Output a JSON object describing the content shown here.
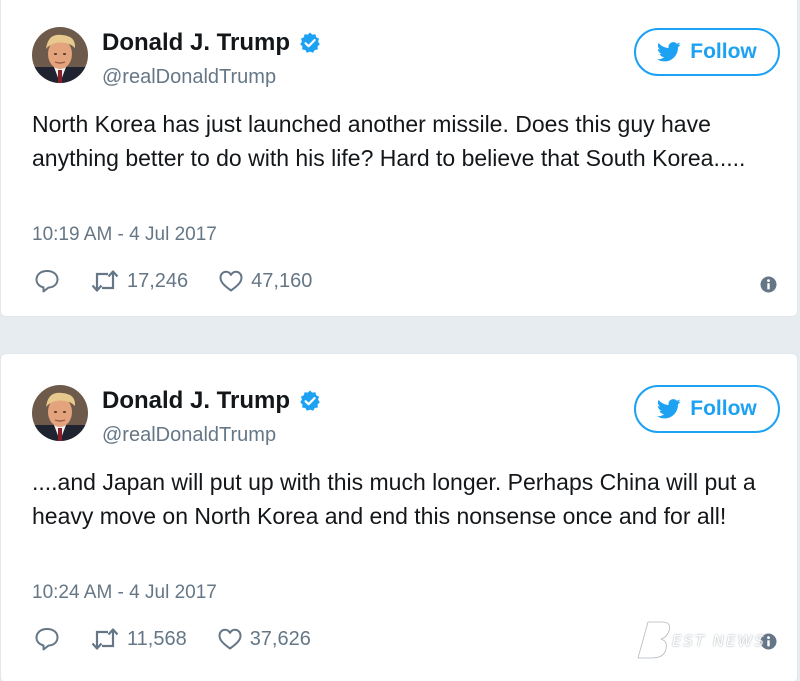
{
  "tweets": [
    {
      "author_name": "Donald J. Trump",
      "handle": "@realDonaldTrump",
      "follow_label": "Follow",
      "text": "North Korea has just launched another missile. Does this guy have anything better to do with his life? Hard to believe that South Korea.....",
      "timestamp": "10:19 AM - 4 Jul 2017",
      "retweets": "17,246",
      "likes": "47,160"
    },
    {
      "author_name": "Donald J. Trump",
      "handle": "@realDonaldTrump",
      "follow_label": "Follow",
      "text": "....and Japan will put up with this much longer. Perhaps China will put a heavy move on North Korea and end this nonsense once and for all!",
      "timestamp": "10:24 AM - 4 Jul 2017",
      "retweets": "11,568",
      "likes": "37,626"
    }
  ],
  "icons": {
    "verified": "verified-badge-icon",
    "follow": "twitter-bird-icon",
    "reply": "reply-icon",
    "retweet": "retweet-icon",
    "like": "heart-icon",
    "info": "info-icon"
  },
  "colors": {
    "accent": "#1da1f2",
    "text_primary": "#14171a",
    "text_secondary": "#657786",
    "border": "#e1e8ed",
    "page_background": "#e6ecf0"
  },
  "watermark": {
    "text": "EST NEWS"
  }
}
